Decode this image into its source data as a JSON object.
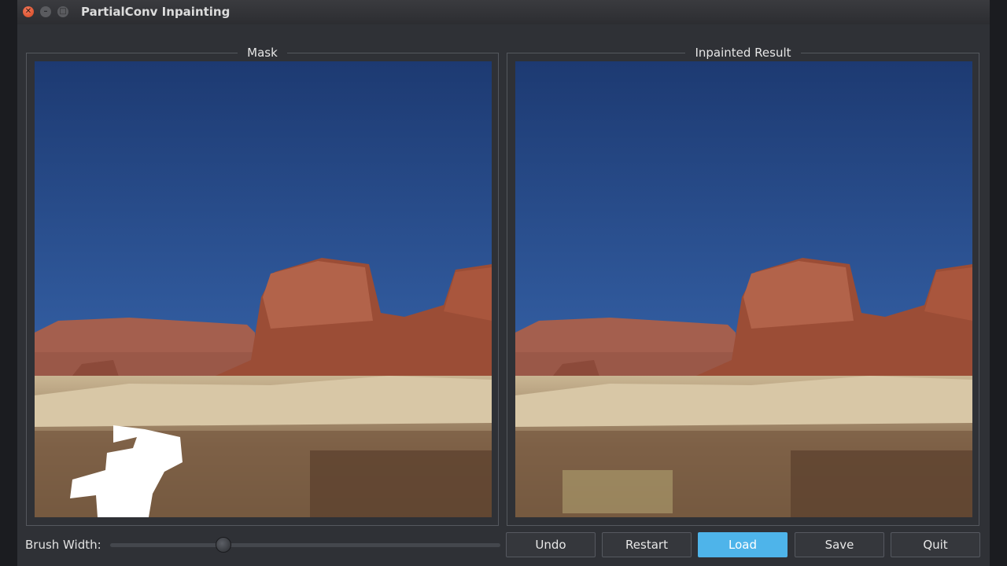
{
  "window": {
    "title": "PartialConv Inpainting"
  },
  "panels": {
    "mask": {
      "title": "Mask"
    },
    "result": {
      "title": "Inpainted Result"
    }
  },
  "controls": {
    "brush_label": "Brush Width:",
    "brush_value": 0.29,
    "buttons": {
      "undo": "Undo",
      "restart": "Restart",
      "load": "Load",
      "save": "Save",
      "quit": "Quit"
    },
    "active_button": "load"
  },
  "colors": {
    "accent": "#4eb4ea",
    "mask": "#ffffff"
  }
}
